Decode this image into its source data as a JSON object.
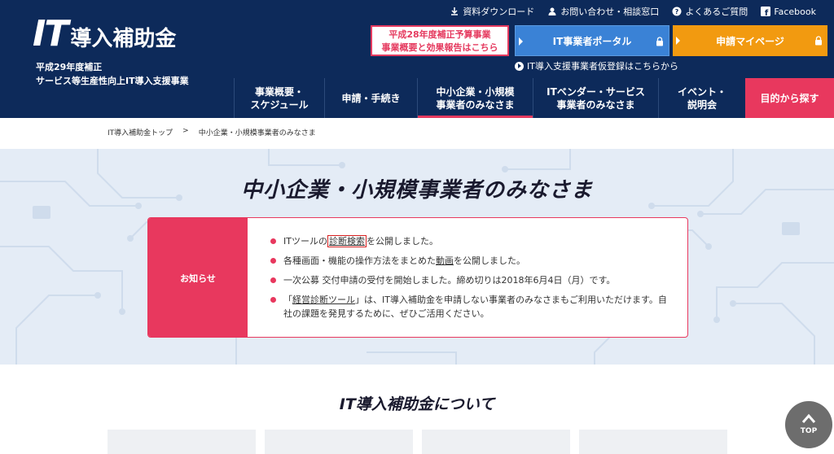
{
  "header": {
    "logo_it": "IT",
    "logo_jp": "導入補助金",
    "subtitle_line1": "平成29年度補正",
    "subtitle_line2": "サービス等生産性向上IT導入支援事業",
    "top_links": [
      {
        "label": "資料ダウンロード",
        "icon": "download-icon"
      },
      {
        "label": "お問い合わせ・相談窓口",
        "icon": "person-icon"
      },
      {
        "label": "よくあるご質問",
        "icon": "question-icon"
      },
      {
        "label": "Facebook",
        "icon": "facebook-icon"
      }
    ],
    "promo_line1": "平成28年度補正予算事業",
    "promo_line2": "事業概要と効果報告はこちら",
    "portal_button": "IT事業者ポータル",
    "mypage_button": "申請マイページ",
    "vendor_note": "IT導入支援事業者仮登録はこちらから",
    "nav": [
      {
        "line1": "事業概要・",
        "line2": "スケジュール"
      },
      {
        "line1": "申請・手続き",
        "line2": ""
      },
      {
        "line1": "中小企業・小規模",
        "line2": "事業者のみなさま"
      },
      {
        "line1": "ITベンダー・サービス",
        "line2": "事業者のみなさま"
      },
      {
        "line1": "イベント・",
        "line2": "説明会"
      },
      {
        "line1": "目的から探す",
        "line2": ""
      }
    ]
  },
  "breadcrumb": {
    "home": "IT導入補助金トップ",
    "separator": ">",
    "current": "中小企業・小規模事業者のみなさま"
  },
  "hero": {
    "title": "中小企業・小規模事業者のみなさま"
  },
  "notice": {
    "label": "お知らせ",
    "items": [
      {
        "pre": "ITツールの",
        "link": "診断検索",
        "post": "を公開しました。"
      },
      {
        "pre": "各種画面・機能の操作方法をまとめた",
        "link": "動画",
        "post": "を公開しました。"
      },
      {
        "pre": "一次公募 交付申請の受付を開始しました。締め切りは2018年6月4日（月）です。",
        "link": "",
        "post": ""
      },
      {
        "pre": "「",
        "link": "経営診断ツール",
        "post": "」は、IT導入補助金を申請しない事業者のみなさまもご利用いただけます。自社の課題を発見するために、ぜひご活用ください。"
      }
    ]
  },
  "about": {
    "title": "IT導入補助金について"
  },
  "totop": {
    "label": "TOP"
  },
  "colors": {
    "header_bg": "#0d2a5a",
    "accent_pink": "#e8385e",
    "portal_blue": "#3a82d6",
    "mypage_orange": "#f29a10"
  }
}
